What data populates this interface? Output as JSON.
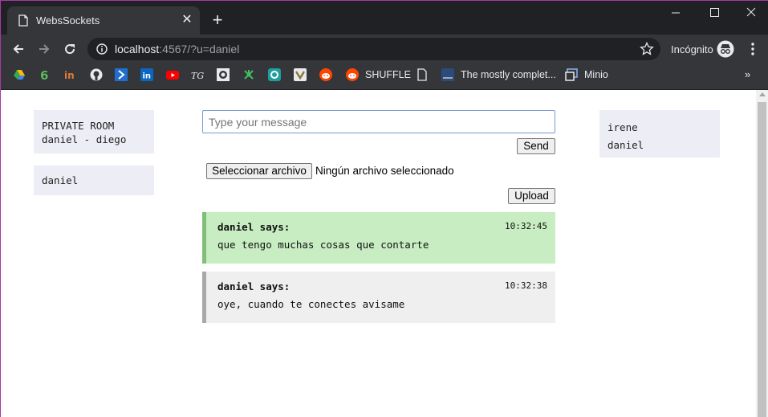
{
  "browser": {
    "tab_title": "WebsSockets",
    "url_host": "localhost",
    "url_rest": ":4567/?u=daniel",
    "incognito_label": "Incógnito",
    "bookmarks": [
      {
        "icon": "google-drive-icon",
        "label": ""
      },
      {
        "icon": "sixbook-icon",
        "label": ""
      },
      {
        "icon": "medium-icon",
        "label": ""
      },
      {
        "icon": "github-icon",
        "label": ""
      },
      {
        "icon": "azure-icon",
        "label": ""
      },
      {
        "icon": "linkedin-icon",
        "label": ""
      },
      {
        "icon": "youtube-icon",
        "label": ""
      },
      {
        "icon": "tg-icon",
        "label": ""
      },
      {
        "icon": "circle-icon",
        "label": ""
      },
      {
        "icon": "network-icon",
        "label": ""
      },
      {
        "icon": "ring-icon",
        "label": ""
      },
      {
        "icon": "vue-icon",
        "label": ""
      },
      {
        "icon": "reddit-icon",
        "label": ""
      },
      {
        "icon": "reddit-icon",
        "label": "SHUFFLE"
      },
      {
        "icon": "page-icon",
        "label": ""
      },
      {
        "icon": "doc-icon",
        "label": "The mostly complet..."
      },
      {
        "icon": "minio-icon",
        "label": "Minio"
      }
    ]
  },
  "sidebar": {
    "room_title": "PRIVATE ROOM",
    "room_members": "daniel - diego",
    "current_user": "daniel"
  },
  "composer": {
    "placeholder": "Type your message",
    "send_label": "Send",
    "file_button_label": "Seleccionar archivo",
    "file_status": "Ningún archivo seleccionado",
    "upload_label": "Upload"
  },
  "messages": [
    {
      "author": "daniel says:",
      "time": "10:32:45",
      "text": "que tengo muchas cosas que contarte",
      "color": "#c8edc2"
    },
    {
      "author": "daniel says:",
      "time": "10:32:38",
      "text": "oye, cuando te conectes avisame",
      "color": "#efefef"
    }
  ],
  "online_users": [
    "irene",
    "daniel"
  ]
}
